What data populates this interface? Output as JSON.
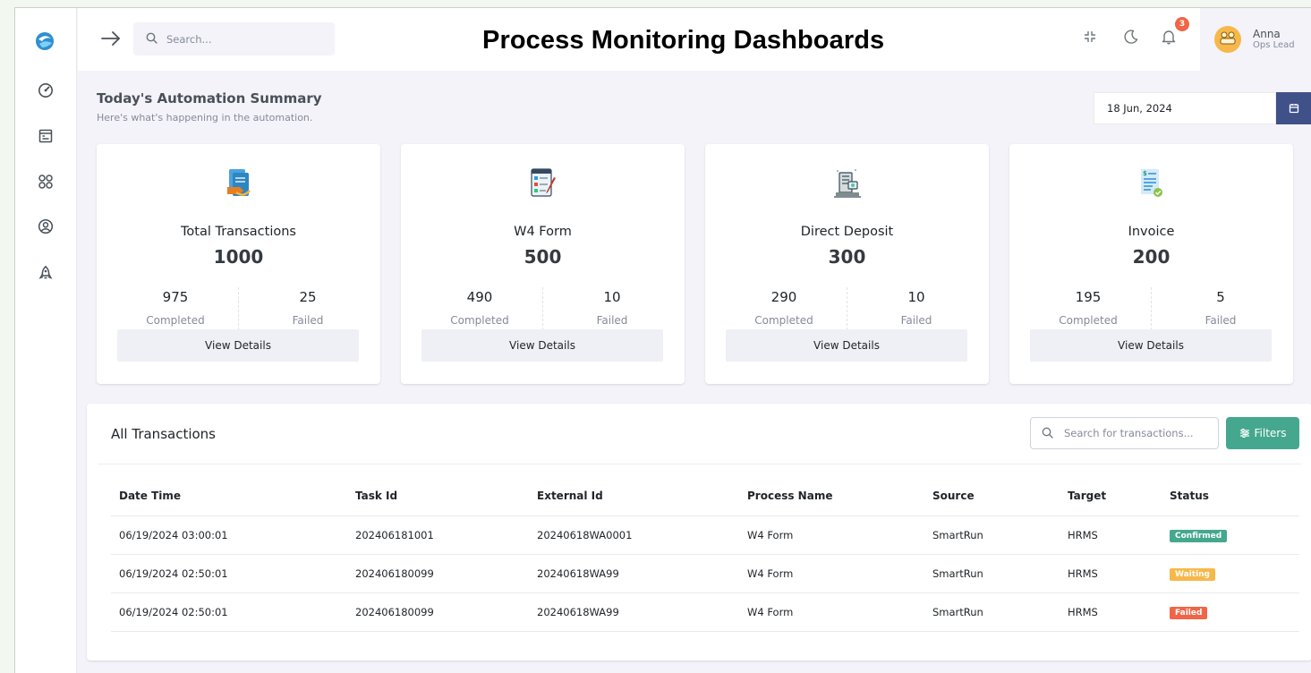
{
  "header": {
    "title": "Process Monitoring Dashboards",
    "search_placeholder": "Search...",
    "notification_count": "3",
    "user": {
      "name": "Anna",
      "role": "Ops Lead"
    }
  },
  "sidebar": {
    "items": [
      {
        "name": "dashboard",
        "icon": "gauge-icon"
      },
      {
        "name": "reports",
        "icon": "calendar-list-icon"
      },
      {
        "name": "apps",
        "icon": "grid-circles-icon"
      },
      {
        "name": "profile",
        "icon": "user-circle-icon"
      },
      {
        "name": "launch",
        "icon": "rocket-icon"
      }
    ]
  },
  "summary": {
    "title": "Today's Automation Summary",
    "subtitle": "Here's what's happening in the automation.",
    "date": "18 Jun, 2024"
  },
  "cards": [
    {
      "title": "Total Transactions",
      "total": "1000",
      "completed": "975",
      "failed": "25",
      "completed_label": "Completed",
      "failed_label": "Failed",
      "button": "View Details",
      "icon": "documents-icon"
    },
    {
      "title": "W4 Form",
      "total": "500",
      "completed": "490",
      "failed": "10",
      "completed_label": "Completed",
      "failed_label": "Failed",
      "button": "View Details",
      "icon": "form-checklist-icon"
    },
    {
      "title": "Direct Deposit",
      "total": "300",
      "completed": "290",
      "failed": "10",
      "completed_label": "Completed",
      "failed_label": "Failed",
      "button": "View Details",
      "icon": "bank-icon"
    },
    {
      "title": "Invoice",
      "total": "200",
      "completed": "195",
      "failed": "5",
      "completed_label": "Completed",
      "failed_label": "Failed",
      "button": "View Details",
      "icon": "invoice-icon"
    }
  ],
  "transactions": {
    "title": "All Transactions",
    "search_placeholder": "Search for transactions...",
    "filter_label": "Filters",
    "columns": [
      "Date Time",
      "Task Id",
      "External Id",
      "Process Name",
      "Source",
      "Target",
      "Status"
    ],
    "rows": [
      {
        "date_time": "06/19/2024 03:00:01",
        "task_id": "202406181001",
        "external_id": "20240618WA0001",
        "process": "W4 Form",
        "source": "SmartRun",
        "target": "HRMS",
        "status": "Confirmed"
      },
      {
        "date_time": "06/19/2024 02:50:01",
        "task_id": "202406180099",
        "external_id": "20240618WA99",
        "process": "W4 Form",
        "source": "SmartRun",
        "target": "HRMS",
        "status": "Waiting"
      },
      {
        "date_time": "06/19/2024 02:50:01",
        "task_id": "202406180099",
        "external_id": "20240618WA99",
        "process": "W4 Form",
        "source": "SmartRun",
        "target": "HRMS",
        "status": "Failed"
      }
    ]
  },
  "colors": {
    "primary": "#405189",
    "success": "#45a88e",
    "warning": "#f7b84b",
    "danger": "#f06548"
  }
}
